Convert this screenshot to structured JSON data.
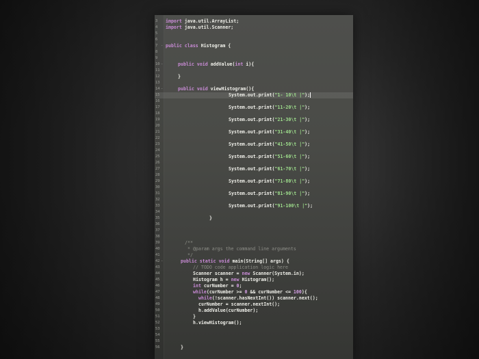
{
  "editor": {
    "lines": [
      {
        "n": "3",
        "code": [
          [
            "kw",
            "import"
          ],
          [
            "tx",
            " java.util.ArrayList;"
          ]
        ]
      },
      {
        "n": "4",
        "code": [
          [
            "kw",
            "import"
          ],
          [
            "tx",
            " java.util.Scanner;"
          ]
        ]
      },
      {
        "n": "5",
        "code": []
      },
      {
        "n": "6",
        "code": []
      },
      {
        "n": "7",
        "code": [
          [
            "kw",
            "public class"
          ],
          [
            "tx",
            " Histogram {"
          ]
        ]
      },
      {
        "n": "8",
        "code": []
      },
      {
        "n": "9",
        "code": []
      },
      {
        "n": "10",
        "code": [
          [
            "kw",
            "public void"
          ],
          [
            "tx",
            " addValue("
          ],
          [
            "kw",
            "int"
          ],
          [
            "tx",
            " i){"
          ]
        ]
      },
      {
        "n": "11",
        "code": []
      },
      {
        "n": "12",
        "code": [
          [
            "tx",
            "}"
          ]
        ]
      },
      {
        "n": "13",
        "code": []
      },
      {
        "n": "14",
        "code": [
          [
            "kw",
            "public void"
          ],
          [
            "tx",
            " viewHistogram(){"
          ]
        ]
      },
      {
        "n": "15",
        "code": [
          [
            "tx",
            "System.out.print("
          ],
          [
            "str",
            "\"1- 10\\t |\""
          ],
          [
            "tx",
            ");"
          ]
        ],
        "active": true
      },
      {
        "n": "16",
        "code": []
      },
      {
        "n": "17",
        "code": [
          [
            "tx",
            "System.out.print("
          ],
          [
            "str",
            "\"11-20\\t |\""
          ],
          [
            "tx",
            ");"
          ]
        ]
      },
      {
        "n": "18",
        "code": []
      },
      {
        "n": "19",
        "code": [
          [
            "tx",
            "System.out.print("
          ],
          [
            "str",
            "\"21-30\\t |\""
          ],
          [
            "tx",
            ");"
          ]
        ]
      },
      {
        "n": "20",
        "code": []
      },
      {
        "n": "21",
        "code": [
          [
            "tx",
            "System.out.print("
          ],
          [
            "str",
            "\"31-40\\t |\""
          ],
          [
            "tx",
            ");"
          ]
        ]
      },
      {
        "n": "22",
        "code": []
      },
      {
        "n": "23",
        "code": [
          [
            "tx",
            "System.out.print("
          ],
          [
            "str",
            "\"41-50\\t |\""
          ],
          [
            "tx",
            ");"
          ]
        ]
      },
      {
        "n": "24",
        "code": []
      },
      {
        "n": "25",
        "code": [
          [
            "tx",
            "System.out.print("
          ],
          [
            "str",
            "\"51-60\\t |\""
          ],
          [
            "tx",
            ");"
          ]
        ]
      },
      {
        "n": "26",
        "code": []
      },
      {
        "n": "27",
        "code": [
          [
            "tx",
            "System.out.print("
          ],
          [
            "str",
            "\"61-70\\t |\""
          ],
          [
            "tx",
            ");"
          ]
        ]
      },
      {
        "n": "28",
        "code": []
      },
      {
        "n": "29",
        "code": [
          [
            "tx",
            "System.out.print("
          ],
          [
            "str",
            "\"71-80\\t |\""
          ],
          [
            "tx",
            ");"
          ]
        ]
      },
      {
        "n": "30",
        "code": []
      },
      {
        "n": "31",
        "code": [
          [
            "tx",
            "System.out.print("
          ],
          [
            "str",
            "\"81-90\\t |\""
          ],
          [
            "tx",
            ");"
          ]
        ]
      },
      {
        "n": "32",
        "code": []
      },
      {
        "n": "33",
        "code": [
          [
            "tx",
            "System.out.print("
          ],
          [
            "str",
            "\"91-100\\t |\""
          ],
          [
            "tx",
            ");"
          ]
        ]
      },
      {
        "n": "34",
        "code": []
      },
      {
        "n": "35",
        "code": [
          [
            "tx",
            "}"
          ]
        ]
      },
      {
        "n": "36",
        "code": []
      },
      {
        "n": "37",
        "code": []
      },
      {
        "n": "38",
        "code": []
      },
      {
        "n": "39",
        "code": [
          [
            "cm",
            "/**"
          ]
        ]
      },
      {
        "n": "40",
        "code": [
          [
            "cm",
            "* @param args the command line arguments"
          ]
        ]
      },
      {
        "n": "41",
        "code": [
          [
            "cm",
            "*/"
          ]
        ]
      },
      {
        "n": "42",
        "code": [
          [
            "kw",
            "public static void"
          ],
          [
            "tx",
            " main(String[] args) {"
          ]
        ]
      },
      {
        "n": "43",
        "code": [
          [
            "cm",
            "// TODO code application logic here"
          ]
        ]
      },
      {
        "n": "44",
        "code": [
          [
            "tx",
            "Scanner scanner = "
          ],
          [
            "kw",
            "new"
          ],
          [
            "tx",
            " Scanner(System.in);"
          ]
        ]
      },
      {
        "n": "45",
        "code": [
          [
            "tx",
            "Histogram h = "
          ],
          [
            "kw",
            "new"
          ],
          [
            "tx",
            " Histogram();"
          ]
        ]
      },
      {
        "n": "46",
        "code": [
          [
            "kw",
            "int"
          ],
          [
            "tx",
            " curNumber = "
          ],
          [
            "num",
            "0"
          ],
          [
            "tx",
            ";"
          ]
        ]
      },
      {
        "n": "47",
        "code": [
          [
            "kw",
            "while"
          ],
          [
            "tx",
            "(curNumber >= "
          ],
          [
            "num",
            "0"
          ],
          [
            "tx",
            " && curNumber <= "
          ],
          [
            "num",
            "100"
          ],
          [
            "tx",
            "){"
          ]
        ]
      },
      {
        "n": "48",
        "code": [
          [
            "kw",
            "while"
          ],
          [
            "tx",
            "(!scanner.hasNextInt()) scanner.next();"
          ]
        ]
      },
      {
        "n": "49",
        "code": [
          [
            "tx",
            "curNumber = scanner.nextInt();"
          ]
        ]
      },
      {
        "n": "50",
        "code": [
          [
            "tx",
            "h.addValue(curNumber);"
          ]
        ]
      },
      {
        "n": "51",
        "code": [
          [
            "tx",
            "}"
          ]
        ]
      },
      {
        "n": "52",
        "code": [
          [
            "tx",
            "h.viewHistogram();"
          ]
        ]
      },
      {
        "n": "53",
        "code": []
      },
      {
        "n": "54",
        "code": []
      },
      {
        "n": "55",
        "code": []
      },
      {
        "n": "56",
        "code": [
          [
            "tx",
            "}"
          ]
        ]
      }
    ]
  }
}
